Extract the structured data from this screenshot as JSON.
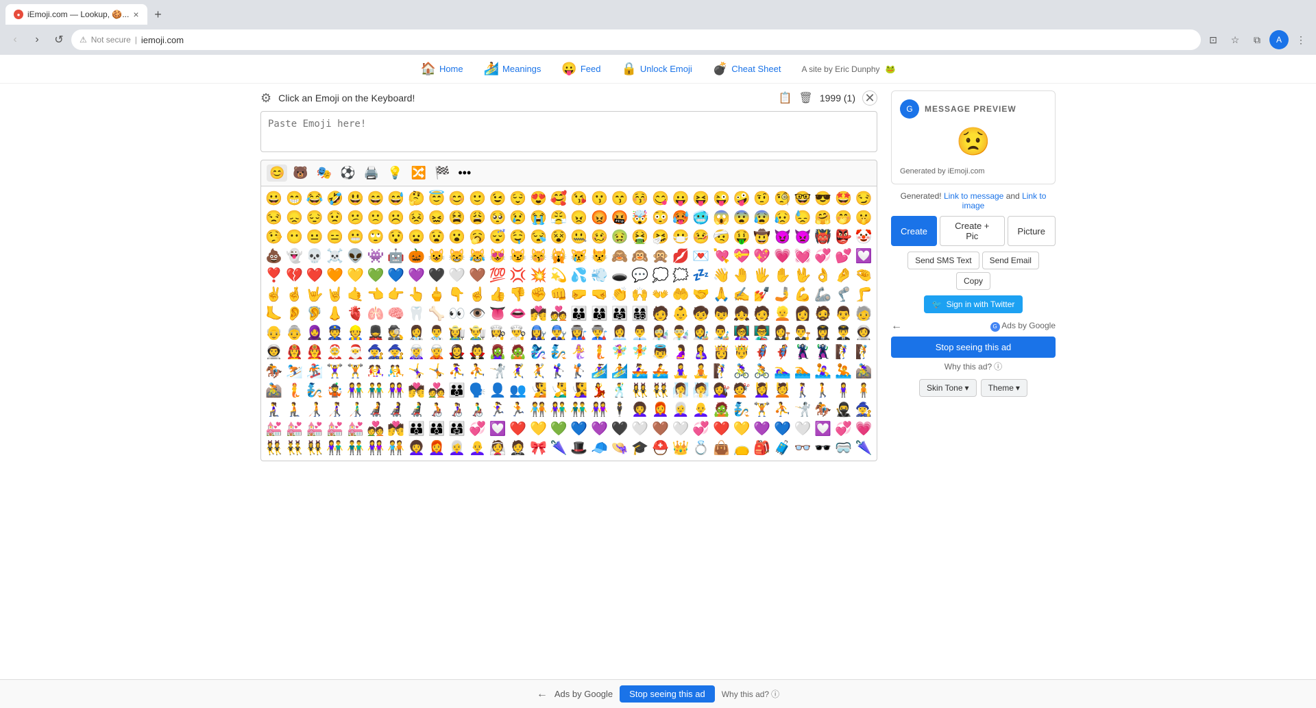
{
  "browser": {
    "tab_favicon": "🌐",
    "tab_title": "iEmoji.com — Lookup, 🍪...",
    "url": "iemoji.com",
    "security_label": "Not secure"
  },
  "nav": {
    "items": [
      {
        "label": "Home",
        "emoji": "🏠"
      },
      {
        "label": "Meanings",
        "emoji": "🏄"
      },
      {
        "label": "Feed",
        "emoji": "😛"
      },
      {
        "label": "Unlock Emoji",
        "emoji": "🔒"
      },
      {
        "label": "Cheat Sheet",
        "emoji": "💣"
      }
    ],
    "site_credit": "A site by Eric Dunphy",
    "site_credit_emoji": "🐸"
  },
  "editor": {
    "instruction": "Click an Emoji on the Keyboard!",
    "counter": "1999 (1)",
    "paste_placeholder": "Paste Emoji here!",
    "categories": [
      "😊",
      "🐻",
      "🎭",
      "⚽",
      "🖨️",
      "💡",
      "🔀",
      "🏁",
      "•••"
    ]
  },
  "message_preview": {
    "title": "MESSAGE PREVIEW",
    "emoji": "😟",
    "credit": "Generated by iEmoji.com"
  },
  "generated": {
    "text": "Generated!",
    "link_to_message": "Link to message",
    "and_text": "and",
    "link_to_image": "Link to image"
  },
  "action_buttons": {
    "create": "Create",
    "create_pic": "Create + Pic",
    "picture": "Picture"
  },
  "share_buttons": {
    "sms": "Send SMS Text",
    "email": "Send Email",
    "copy": "Copy"
  },
  "twitter": {
    "label": "Sign in with Twitter"
  },
  "ads": {
    "label": "Ads by Google",
    "stop_label": "Stop seeing this ad",
    "why_label": "Why this ad?",
    "info_icon": "ⓘ"
  },
  "bottom_ads": {
    "arrow": "←",
    "label": "Ads by Google",
    "stop_label": "Stop seeing this ad",
    "why_label": "Why this ad?",
    "info_icon": "ⓘ"
  },
  "options": {
    "skin_tone": "Skin Tone",
    "theme": "Theme",
    "dropdown_icon": "▾"
  },
  "emojis": {
    "row1": [
      "😀",
      "😁",
      "😂",
      "🤣",
      "😃",
      "😄",
      "😅",
      "🤔",
      "😇",
      "😊",
      "🙂",
      "😉",
      "😌",
      "😍",
      "🥰",
      "😘",
      "😗",
      "😙",
      "😚",
      "😋",
      "😛",
      "😝",
      "😜",
      "🤪",
      "🤨",
      "🧐",
      "🤓",
      "😎",
      "🤩",
      "😏"
    ],
    "row2": [
      "😒",
      "😞",
      "😔",
      "😟",
      "😕",
      "🙁",
      "☹️",
      "😣",
      "😖",
      "😫",
      "😩",
      "🥺",
      "😢",
      "😭",
      "😤",
      "😠",
      "😡",
      "🤬",
      "🤯",
      "😳",
      "🥵",
      "🥶",
      "😱",
      "😨",
      "😰",
      "😥",
      "😓",
      "🤗",
      "🤭",
      "🤫"
    ],
    "row3": [
      "🤥",
      "😶",
      "😐",
      "😑",
      "😬",
      "🙄",
      "😯",
      "😦",
      "😧",
      "😮",
      "🥱",
      "😴",
      "🤤",
      "😪",
      "😵",
      "🤐",
      "🥴",
      "🤢",
      "🤮",
      "🤧",
      "😷",
      "🤒",
      "🤕",
      "🤑",
      "🤠",
      "😈",
      "👿",
      "👹",
      "👺",
      "🤡"
    ],
    "row4": [
      "💩",
      "👻",
      "💀",
      "☠️",
      "👽",
      "👾",
      "🤖",
      "🎃",
      "😺",
      "😸",
      "😹",
      "😻",
      "😼",
      "😽",
      "🙀",
      "😿",
      "😾",
      "🙈",
      "🙉",
      "🙊",
      "💋",
      "💌",
      "💘",
      "💝",
      "💖",
      "💗",
      "💓",
      "💞",
      "💕",
      "💟"
    ],
    "row5": [
      "❣️",
      "💔",
      "❤️",
      "🧡",
      "💛",
      "💚",
      "💙",
      "💜",
      "🖤",
      "🤍",
      "🤎",
      "💯",
      "💢",
      "💥",
      "💫",
      "💦",
      "💨",
      "🕳️",
      "💬",
      "💭",
      "🗯️",
      "💤",
      "👋",
      "🤚",
      "🖐️",
      "✋",
      "🖖",
      "👌",
      "🤌",
      "🤏"
    ],
    "row6": [
      "✌️",
      "🤞",
      "🤟",
      "🤘",
      "🤙",
      "👈",
      "👉",
      "👆",
      "🖕",
      "👇",
      "☝️",
      "👍",
      "👎",
      "✊",
      "👊",
      "🤛",
      "🤜",
      "👏",
      "🙌",
      "👐",
      "🤲",
      "🤝",
      "🙏",
      "✍️",
      "💅",
      "🤳",
      "💪",
      "🦾",
      "🦿",
      "🦵"
    ],
    "row7": [
      "🦶",
      "👂",
      "🦻",
      "👃",
      "🫀",
      "🫁",
      "🧠",
      "🦷",
      "🦴",
      "👀",
      "👁️",
      "👅",
      "👄",
      "💏",
      "💑",
      "👪",
      "👨‍👩‍👦",
      "👨‍👩‍👧",
      "👨‍👩‍👧‍👦",
      "🧑",
      "👶",
      "🧒",
      "👦",
      "👧",
      "🧑",
      "👱",
      "👩",
      "🧔",
      "👨",
      "🧓"
    ],
    "row8": [
      "👴",
      "👵",
      "🧕",
      "👮",
      "👷",
      "💂",
      "🕵️",
      "👩‍⚕️",
      "👨‍⚕️",
      "👩‍🌾",
      "👨‍🌾",
      "👩‍🍳",
      "👨‍🍳",
      "👩‍🔧",
      "👨‍🔧",
      "👩‍🏭",
      "👨‍🏭",
      "👩‍💼",
      "👨‍💼",
      "👩‍🔬",
      "👨‍🔬",
      "👩‍🎨",
      "👨‍🎨",
      "👩‍🏫",
      "👨‍🏫",
      "👩‍⚖️",
      "👨‍⚖️",
      "👩‍✈️",
      "👨‍✈️",
      "👩‍🚀"
    ],
    "row9": [
      "👨‍🚀",
      "👩‍🚒",
      "👨‍🚒",
      "🤶",
      "🎅",
      "🧙‍♀️",
      "🧙",
      "🧝‍♀️",
      "🧝",
      "🧛‍♀️",
      "🧛",
      "🧟‍♀️",
      "🧟",
      "🧞‍♀️",
      "🧞",
      "🧜‍♀️",
      "🧜",
      "🧚‍♀️",
      "🧚",
      "👼",
      "🤰",
      "🤱",
      "👸",
      "🤴",
      "🦸‍♀️",
      "🦸",
      "🦹‍♀️",
      "🦹",
      "🧗‍♀️",
      "🧗"
    ],
    "row10": [
      "🏇",
      "⛷️",
      "🏂",
      "🏋️‍♀️",
      "🏋️",
      "🤼‍♀️",
      "🤼",
      "🤸‍♀️",
      "🤸",
      "⛹️‍♀️",
      "⛹️",
      "🤺",
      "🤾‍♀️",
      "🤾",
      "🏌️‍♀️",
      "🏌️",
      "🏄‍♀️",
      "🏄",
      "🚣‍♀️",
      "🚣",
      "🧘‍♀️",
      "🧘",
      "🧗‍♀️",
      "🚴‍♀️",
      "🚴",
      "🏊‍♀️",
      "🏊",
      "🤽‍♀️",
      "🤽",
      "🚵‍♀️"
    ],
    "row11": [
      "🚵",
      "🧜",
      "🧞",
      "🤹",
      "👫",
      "👬",
      "👭",
      "💏",
      "💑",
      "👪",
      "🗣️",
      "👤",
      "👥",
      "🧏",
      "🧏‍♂️",
      "🧏‍♀️",
      "💃",
      "🕺",
      "👯‍♀️",
      "👯",
      "🧖‍♀️",
      "🧖",
      "💇‍♀️",
      "💇",
      "💆‍♀️",
      "💆",
      "🚶‍♀️",
      "🚶",
      "🧍‍♀️",
      "🧍"
    ],
    "row12": [
      "🧎‍♀️",
      "🧎",
      "🧑‍🦯",
      "👩‍🦯",
      "👨‍🦯",
      "🧑‍🦼",
      "👩‍🦼",
      "👨‍🦼",
      "🧑‍🦽",
      "👩‍🦽",
      "👨‍🦽",
      "🏃‍♀️",
      "🏃",
      "🧑‍🤝‍🧑",
      "👫",
      "👬",
      "👭",
      "🕴️",
      "👩‍🦱",
      "👩‍🦰",
      "👩‍🦳",
      "👩‍🦲",
      "🧟",
      "🧞",
      "🏋️",
      "⛹️",
      "🤺",
      "🏇",
      "🥷",
      "🧙‍♀️"
    ],
    "row13": [
      "💒",
      "💒",
      "💒",
      "💒",
      "💒",
      "💑",
      "💏",
      "👪",
      "👨‍👩‍👦",
      "👨‍👩‍👧",
      "💞",
      "💟",
      "❤️",
      "💛",
      "💚",
      "💙",
      "💜",
      "🖤",
      "🤍",
      "🤎",
      "🤍",
      "💞",
      "❤️",
      "💛",
      "💜",
      "💙",
      "🤍",
      "💟",
      "💞",
      "💗"
    ],
    "row14": [
      "👯",
      "👯‍♂️",
      "👯‍♀️",
      "👫",
      "👬",
      "👭",
      "🧑‍🤝‍🧑",
      "👩‍🦱",
      "👩‍🦰",
      "👩‍🦳",
      "👩‍🦲",
      "👰",
      "🤵",
      "🎀",
      "🌂",
      "🎩",
      "🧢",
      "👒",
      "🎓",
      "⛑️",
      "👑",
      "💍",
      "👜",
      "👝",
      "🎒",
      "🧳",
      "👓",
      "🕶️",
      "🥽",
      "🌂"
    ]
  }
}
